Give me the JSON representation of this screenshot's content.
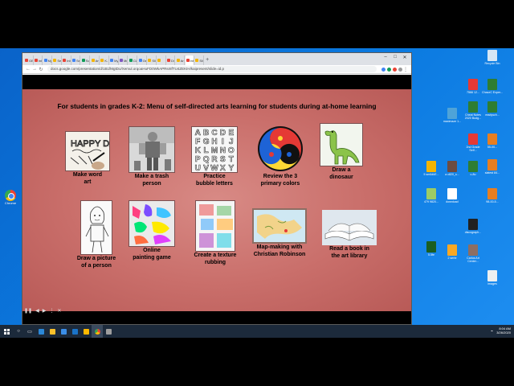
{
  "tabs": [
    {
      "label": "GE",
      "color": "#ea4335"
    },
    {
      "label": "Inb",
      "color": "#ea4335"
    },
    {
      "label": "My",
      "color": "#4285f4"
    },
    {
      "label": "Self",
      "color": "#f4b400"
    },
    {
      "label": "Inb",
      "color": "#ea4335"
    },
    {
      "label": "Sea",
      "color": "#4285f4"
    },
    {
      "label": "Sch",
      "color": "#0f9d58"
    },
    {
      "label": "Art",
      "color": "#f4b400"
    },
    {
      "label": "K-",
      "color": "#f4b400"
    },
    {
      "label": "My",
      "color": "#4285f4"
    },
    {
      "label": "Me",
      "color": "#7e57c2"
    },
    {
      "label": "Cla",
      "color": "#0f9d58"
    },
    {
      "label": "Ge",
      "color": "#4285f4"
    },
    {
      "label": "Sli",
      "color": "#f4b400"
    },
    {
      "label": "",
      "color": "#f4b400"
    },
    {
      "label": "Dir",
      "color": "#ea4335"
    },
    {
      "label": "Art",
      "color": "#f4b400"
    },
    {
      "label": "Inb",
      "color": "#ea4335"
    },
    {
      "label": "Sli",
      "color": "#f4b400"
    }
  ],
  "address": "docs.google.com/presentation/d/1B1fMgtDo/Xemul.orqoaHuFD0WkAPRsr8fTU4ZEKIH/kaipresent/slide=id.p",
  "slide": {
    "title": "For students in grades K-2: Menu of self-directed arts learning for students during at-home learning",
    "row1": [
      {
        "caption1": "Make word",
        "caption2": "art",
        "icon": "word-art-image"
      },
      {
        "caption1": "Make a trash",
        "caption2": "person",
        "icon": "trash-person-image"
      },
      {
        "caption1": "Practice",
        "caption2": "bubble letters",
        "icon": "bubble-letters-image"
      },
      {
        "caption1": "Review the 3",
        "caption2": "primary colors",
        "icon": "primary-colors-image"
      },
      {
        "caption1": "Draw a",
        "caption2": "dinosaur",
        "icon": "dinosaur-image"
      }
    ],
    "row2": [
      {
        "caption1": "Draw a picture",
        "caption2": "of a person",
        "icon": "person-drawing-image"
      },
      {
        "caption1": "Online",
        "caption2": "painting game",
        "icon": "painting-game-image"
      },
      {
        "caption1": "Create a texture",
        "caption2": "rubbing",
        "icon": "texture-rubbing-image"
      },
      {
        "caption1": "Map-making with",
        "caption2": "Christian Robinson",
        "icon": "map-image"
      },
      {
        "caption1": "Read a book in",
        "caption2": "the art library",
        "icon": "book-image"
      }
    ],
    "letters": "ABCDEFGHIJKLMNOPQRSTUVWXYZ",
    "word_art_text": "HAPPY DAY"
  },
  "status_url": "https://www.google.com/url?q=https://www.youtube.com/watch?v%3DWhx5yKXe1_s%",
  "desktop_left": {
    "label": "Chrome"
  },
  "desktop_icons": [
    {
      "label": "Recycle Bin",
      "color": "#d6e6f5"
    },
    {
      "label": "7566 12...",
      "color": "#e53935"
    },
    {
      "label": "ChazzC Exper...",
      "color": "#2e7d32"
    },
    {
      "label": "Cheat Notes 2020 Budg...",
      "color": "#2e7d32"
    },
    {
      "label": "readysch...",
      "color": "#2e7d32"
    },
    {
      "label": "maximaze 1...",
      "color": "#4fa3d8"
    },
    {
      "label": "2nd Grade Self...",
      "color": "#e53935"
    },
    {
      "label": "55-00...",
      "color": "#e67e22"
    },
    {
      "label": "slatest 84...",
      "color": "#e67e22"
    },
    {
      "label": "5 sm6dkE...",
      "color": "#f4b400"
    },
    {
      "label": "a c820_s...",
      "color": "#6d4c41"
    },
    {
      "label": "c-8u",
      "color": "#2e7d32"
    },
    {
      "label": "479 9820...",
      "color": "#9ccc65"
    },
    {
      "label": "download",
      "color": "#ffffff"
    },
    {
      "label": "98-00-5...",
      "color": "#e67e22"
    },
    {
      "label": "discograph...",
      "color": "#212121"
    },
    {
      "label": "5.5fe",
      "color": "#1b5e20"
    },
    {
      "label": "2 serte",
      "color": "#f9a825"
    },
    {
      "label": "Carlos Art Center...",
      "color": "#8d6e63"
    },
    {
      "label": "images",
      "color": "#eceff1"
    }
  ],
  "tray": {
    "time": "8:04 AM",
    "date": "3/26/2020"
  }
}
